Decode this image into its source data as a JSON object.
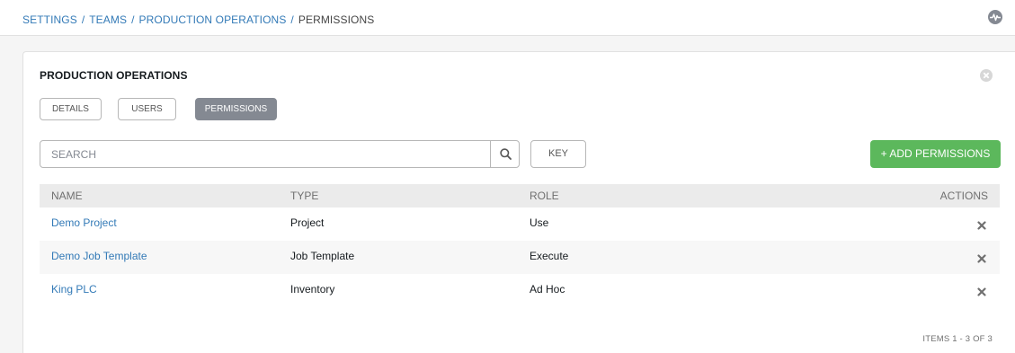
{
  "breadcrumb": {
    "items": [
      "SETTINGS",
      "TEAMS",
      "PRODUCTION OPERATIONS"
    ],
    "separator": "/",
    "current": "PERMISSIONS"
  },
  "header": {
    "activity_icon": "activity-pulse-icon"
  },
  "panel": {
    "title": "PRODUCTION OPERATIONS",
    "close_icon": "close-circle-icon"
  },
  "tabs": [
    {
      "label": "DETAILS",
      "active": false
    },
    {
      "label": "USERS",
      "active": false
    },
    {
      "label": "PERMISSIONS",
      "active": true
    }
  ],
  "search": {
    "placeholder": "SEARCH",
    "value": "",
    "icon": "search-icon"
  },
  "key_button": "KEY",
  "add_button": "+ ADD PERMISSIONS",
  "table": {
    "columns": [
      "NAME",
      "TYPE",
      "ROLE",
      "ACTIONS"
    ],
    "rows": [
      {
        "name": "Demo Project",
        "type": "Project",
        "role": "Use"
      },
      {
        "name": "Demo Job Template",
        "type": "Job Template",
        "role": "Execute"
      },
      {
        "name": "King PLC",
        "type": "Inventory",
        "role": "Ad Hoc"
      }
    ],
    "row_action_icon": "remove-x-icon"
  },
  "pagination": {
    "items_label": "ITEMS  1 - 3 OF 3"
  },
  "colors": {
    "link": "#337ab7",
    "active_tab": "#848992",
    "add_button": "#5cb85c",
    "header_row": "#ebebeb"
  }
}
